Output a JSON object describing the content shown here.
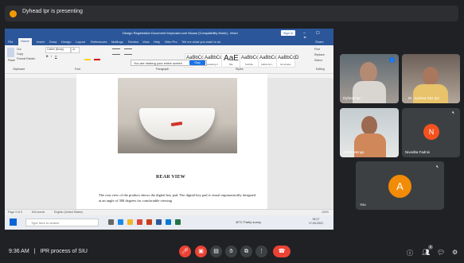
{
  "presenting": {
    "text": "Dyhead Ipr is presenting"
  },
  "word": {
    "title": "Design Registration Document Keyboard.com Mouse [Compatibility Mode] - Word",
    "sign_in": "Sign in",
    "window_buttons": "–  ☐  ✕",
    "tabs": [
      "File",
      "Home",
      "Insert",
      "Draw",
      "Design",
      "Layout",
      "References",
      "Mailings",
      "Review",
      "View",
      "Help",
      "Nitro Pro",
      "Tell me what you want to do"
    ],
    "share": "Share",
    "clipboard": {
      "paste": "Paste",
      "cut": "Cut",
      "copy": "Copy",
      "format": "Format Painter",
      "group": "Clipboard"
    },
    "font": {
      "name": "Calibri (Body)",
      "size": "11",
      "group": "Font"
    },
    "paragraph_group": "Paragraph",
    "styles": [
      {
        "sample": "AaBbCc",
        "label": "Heading 1"
      },
      {
        "sample": "AaBbCcI",
        "label": "Heading 2"
      },
      {
        "sample": "AaE",
        "label": "Title"
      },
      {
        "sample": "AaBbCcI",
        "label": "Subtitle"
      },
      {
        "sample": "AaBbCcD",
        "label": "Subtle Em..."
      },
      {
        "sample": "AaBbCcD",
        "label": "Emphasis"
      }
    ],
    "styles_group": "Styles",
    "editing": {
      "find": "Find",
      "replace": "Replace",
      "select": "Select",
      "group": "Editing"
    },
    "share_notice": "You are sharing your entire screen",
    "stop_sharing": "Stop Sharing",
    "doc": {
      "heading": "REAR VIEW",
      "body": "The rear view of the product shows the digital key pad. The digital key pad is visual ergonomically designed at an angle of 300 degrees for comfortable viewing"
    },
    "status": {
      "page": "Page 3 of 5",
      "words": "604 words",
      "lang": "English (United States)",
      "zoom": "100%"
    },
    "taskbar": {
      "search": "Type here to search",
      "weather": "30°C  Partly sunny",
      "time": "09:17",
      "date": "17-09-2021"
    }
  },
  "participants": [
    {
      "name": "Dyhead Ipr",
      "speaking": true
    },
    {
      "name": "Dr. Jyotsna SIU Ip3",
      "speaking": false
    },
    {
      "name": "Shruti Menge",
      "speaking": false
    },
    {
      "name": "Nivedita Fadnis",
      "initial": "N",
      "color": "#f4511e"
    },
    {
      "name": "You",
      "initial": "A",
      "color": "#f28b06"
    }
  ],
  "meeting": {
    "time": "9:36 AM",
    "separator": "|",
    "title": "IPR process of SIU"
  },
  "controls": {
    "mic": "mic-off-icon",
    "camera": "camera-off-icon",
    "captions": "captions-icon",
    "raise_hand": "raise-hand-icon",
    "present": "present-icon",
    "more": "more-icon",
    "hangup": "hangup-icon",
    "participant_count": "5"
  }
}
